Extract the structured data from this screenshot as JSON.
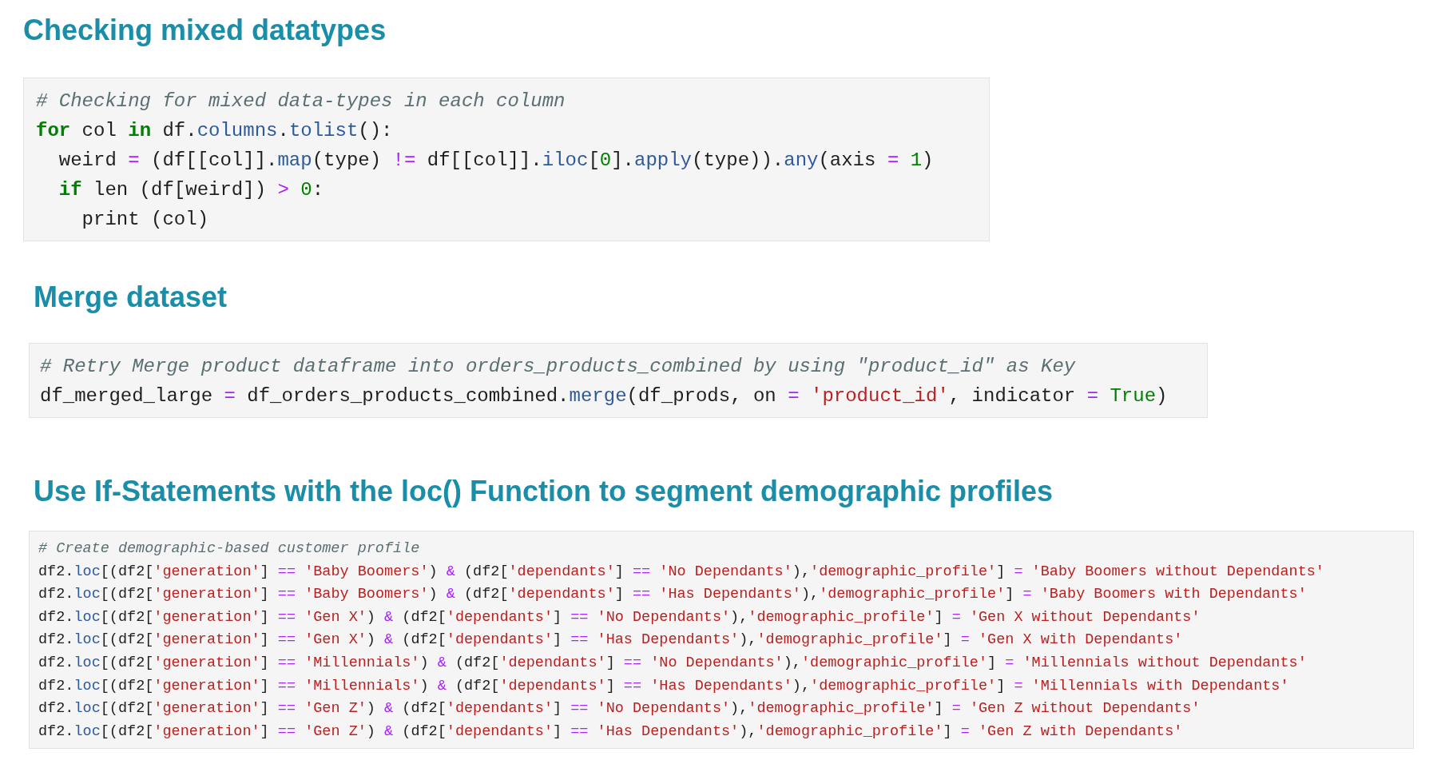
{
  "sections": [
    {
      "heading": "Checking mixed datatypes",
      "code_lines": [
        [
          {
            "kind": "comment",
            "text": "# Checking for mixed data-types in each column"
          }
        ],
        [
          {
            "kind": "keyword",
            "text": "for"
          },
          {
            "kind": "plain",
            "text": " col "
          },
          {
            "kind": "keyword",
            "text": "in"
          },
          {
            "kind": "plain",
            "text": " df."
          },
          {
            "kind": "attribute",
            "text": "columns"
          },
          {
            "kind": "plain",
            "text": "."
          },
          {
            "kind": "attribute",
            "text": "tolist"
          },
          {
            "kind": "plain",
            "text": "():"
          }
        ],
        [
          {
            "kind": "plain",
            "text": "  weird "
          },
          {
            "kind": "operator",
            "text": "= "
          },
          {
            "kind": "plain",
            "text": "(df[[col]]."
          },
          {
            "kind": "attribute",
            "text": "map"
          },
          {
            "kind": "plain",
            "text": "(type) "
          },
          {
            "kind": "operator",
            "text": "!= "
          },
          {
            "kind": "plain",
            "text": "df[[col]]."
          },
          {
            "kind": "attribute",
            "text": "iloc"
          },
          {
            "kind": "plain",
            "text": "["
          },
          {
            "kind": "number",
            "text": "0"
          },
          {
            "kind": "plain",
            "text": "]."
          },
          {
            "kind": "attribute",
            "text": "apply"
          },
          {
            "kind": "plain",
            "text": "(type))."
          },
          {
            "kind": "attribute",
            "text": "any"
          },
          {
            "kind": "plain",
            "text": "(axis "
          },
          {
            "kind": "operator",
            "text": "= "
          },
          {
            "kind": "number",
            "text": "1"
          },
          {
            "kind": "plain",
            "text": ")"
          }
        ],
        [
          {
            "kind": "keyword",
            "text": "  if"
          },
          {
            "kind": "plain",
            "text": " len (df[weird]) "
          },
          {
            "kind": "operator",
            "text": "> "
          },
          {
            "kind": "number",
            "text": "0"
          },
          {
            "kind": "plain",
            "text": ":"
          }
        ],
        [
          {
            "kind": "plain",
            "text": "    print (col)"
          }
        ]
      ]
    },
    {
      "heading": "Merge dataset",
      "code_lines": [
        [
          {
            "kind": "comment",
            "text": "# Retry Merge product dataframe into orders_products_combined by using \"product_id\" as Key"
          }
        ],
        [
          {
            "kind": "plain",
            "text": "df_merged_large "
          },
          {
            "kind": "operator",
            "text": "= "
          },
          {
            "kind": "plain",
            "text": "df_orders_products_combined."
          },
          {
            "kind": "attribute",
            "text": "merge"
          },
          {
            "kind": "plain",
            "text": "(df_prods, on "
          },
          {
            "kind": "operator",
            "text": "= "
          },
          {
            "kind": "string",
            "text": "'product_id'"
          },
          {
            "kind": "plain",
            "text": ", indicator "
          },
          {
            "kind": "operator",
            "text": "= "
          },
          {
            "kind": "constant",
            "text": "True"
          },
          {
            "kind": "plain",
            "text": ")"
          }
        ]
      ]
    },
    {
      "heading": "Use If-Statements with the loc() Function to segment demographic profiles",
      "code_lines": [
        [
          {
            "kind": "comment",
            "text": "# Create demographic-based customer profile"
          }
        ],
        [
          {
            "kind": "plain",
            "text": "df2."
          },
          {
            "kind": "attribute",
            "text": "loc"
          },
          {
            "kind": "plain",
            "text": "[(df2["
          },
          {
            "kind": "string",
            "text": "'generation'"
          },
          {
            "kind": "plain",
            "text": "] "
          },
          {
            "kind": "operator",
            "text": "== "
          },
          {
            "kind": "string",
            "text": "'Baby Boomers'"
          },
          {
            "kind": "plain",
            "text": ") "
          },
          {
            "kind": "operator",
            "text": "&"
          },
          {
            "kind": "plain",
            "text": " (df2["
          },
          {
            "kind": "string",
            "text": "'dependants'"
          },
          {
            "kind": "plain",
            "text": "] "
          },
          {
            "kind": "operator",
            "text": "== "
          },
          {
            "kind": "string",
            "text": "'No Dependants'"
          },
          {
            "kind": "plain",
            "text": "),"
          },
          {
            "kind": "string",
            "text": "'demographic_profile'"
          },
          {
            "kind": "plain",
            "text": "] "
          },
          {
            "kind": "operator",
            "text": "= "
          },
          {
            "kind": "string",
            "text": "'Baby Boomers without Dependants'"
          }
        ],
        [
          {
            "kind": "plain",
            "text": "df2."
          },
          {
            "kind": "attribute",
            "text": "loc"
          },
          {
            "kind": "plain",
            "text": "[(df2["
          },
          {
            "kind": "string",
            "text": "'generation'"
          },
          {
            "kind": "plain",
            "text": "] "
          },
          {
            "kind": "operator",
            "text": "== "
          },
          {
            "kind": "string",
            "text": "'Baby Boomers'"
          },
          {
            "kind": "plain",
            "text": ") "
          },
          {
            "kind": "operator",
            "text": "&"
          },
          {
            "kind": "plain",
            "text": " (df2["
          },
          {
            "kind": "string",
            "text": "'dependants'"
          },
          {
            "kind": "plain",
            "text": "] "
          },
          {
            "kind": "operator",
            "text": "== "
          },
          {
            "kind": "string",
            "text": "'Has Dependants'"
          },
          {
            "kind": "plain",
            "text": "),"
          },
          {
            "kind": "string",
            "text": "'demographic_profile'"
          },
          {
            "kind": "plain",
            "text": "] "
          },
          {
            "kind": "operator",
            "text": "= "
          },
          {
            "kind": "string",
            "text": "'Baby Boomers with Dependants'"
          }
        ],
        [
          {
            "kind": "plain",
            "text": "df2."
          },
          {
            "kind": "attribute",
            "text": "loc"
          },
          {
            "kind": "plain",
            "text": "[(df2["
          },
          {
            "kind": "string",
            "text": "'generation'"
          },
          {
            "kind": "plain",
            "text": "] "
          },
          {
            "kind": "operator",
            "text": "== "
          },
          {
            "kind": "string",
            "text": "'Gen X'"
          },
          {
            "kind": "plain",
            "text": ") "
          },
          {
            "kind": "operator",
            "text": "&"
          },
          {
            "kind": "plain",
            "text": " (df2["
          },
          {
            "kind": "string",
            "text": "'dependants'"
          },
          {
            "kind": "plain",
            "text": "] "
          },
          {
            "kind": "operator",
            "text": "== "
          },
          {
            "kind": "string",
            "text": "'No Dependants'"
          },
          {
            "kind": "plain",
            "text": "),"
          },
          {
            "kind": "string",
            "text": "'demographic_profile'"
          },
          {
            "kind": "plain",
            "text": "] "
          },
          {
            "kind": "operator",
            "text": "= "
          },
          {
            "kind": "string",
            "text": "'Gen X without Dependants'"
          }
        ],
        [
          {
            "kind": "plain",
            "text": "df2."
          },
          {
            "kind": "attribute",
            "text": "loc"
          },
          {
            "kind": "plain",
            "text": "[(df2["
          },
          {
            "kind": "string",
            "text": "'generation'"
          },
          {
            "kind": "plain",
            "text": "] "
          },
          {
            "kind": "operator",
            "text": "== "
          },
          {
            "kind": "string",
            "text": "'Gen X'"
          },
          {
            "kind": "plain",
            "text": ") "
          },
          {
            "kind": "operator",
            "text": "&"
          },
          {
            "kind": "plain",
            "text": " (df2["
          },
          {
            "kind": "string",
            "text": "'dependants'"
          },
          {
            "kind": "plain",
            "text": "] "
          },
          {
            "kind": "operator",
            "text": "== "
          },
          {
            "kind": "string",
            "text": "'Has Dependants'"
          },
          {
            "kind": "plain",
            "text": "),"
          },
          {
            "kind": "string",
            "text": "'demographic_profile'"
          },
          {
            "kind": "plain",
            "text": "] "
          },
          {
            "kind": "operator",
            "text": "= "
          },
          {
            "kind": "string",
            "text": "'Gen X with Dependants'"
          }
        ],
        [
          {
            "kind": "plain",
            "text": "df2."
          },
          {
            "kind": "attribute",
            "text": "loc"
          },
          {
            "kind": "plain",
            "text": "[(df2["
          },
          {
            "kind": "string",
            "text": "'generation'"
          },
          {
            "kind": "plain",
            "text": "] "
          },
          {
            "kind": "operator",
            "text": "== "
          },
          {
            "kind": "string",
            "text": "'Millennials'"
          },
          {
            "kind": "plain",
            "text": ") "
          },
          {
            "kind": "operator",
            "text": "&"
          },
          {
            "kind": "plain",
            "text": " (df2["
          },
          {
            "kind": "string",
            "text": "'dependants'"
          },
          {
            "kind": "plain",
            "text": "] "
          },
          {
            "kind": "operator",
            "text": "== "
          },
          {
            "kind": "string",
            "text": "'No Dependants'"
          },
          {
            "kind": "plain",
            "text": "),"
          },
          {
            "kind": "string",
            "text": "'demographic_profile'"
          },
          {
            "kind": "plain",
            "text": "] "
          },
          {
            "kind": "operator",
            "text": "= "
          },
          {
            "kind": "string",
            "text": "'Millennials without Dependants'"
          }
        ],
        [
          {
            "kind": "plain",
            "text": "df2."
          },
          {
            "kind": "attribute",
            "text": "loc"
          },
          {
            "kind": "plain",
            "text": "[(df2["
          },
          {
            "kind": "string",
            "text": "'generation'"
          },
          {
            "kind": "plain",
            "text": "] "
          },
          {
            "kind": "operator",
            "text": "== "
          },
          {
            "kind": "string",
            "text": "'Millennials'"
          },
          {
            "kind": "plain",
            "text": ") "
          },
          {
            "kind": "operator",
            "text": "&"
          },
          {
            "kind": "plain",
            "text": " (df2["
          },
          {
            "kind": "string",
            "text": "'dependants'"
          },
          {
            "kind": "plain",
            "text": "] "
          },
          {
            "kind": "operator",
            "text": "== "
          },
          {
            "kind": "string",
            "text": "'Has Dependants'"
          },
          {
            "kind": "plain",
            "text": "),"
          },
          {
            "kind": "string",
            "text": "'demographic_profile'"
          },
          {
            "kind": "plain",
            "text": "] "
          },
          {
            "kind": "operator",
            "text": "= "
          },
          {
            "kind": "string",
            "text": "'Millennials with Dependants'"
          }
        ],
        [
          {
            "kind": "plain",
            "text": "df2."
          },
          {
            "kind": "attribute",
            "text": "loc"
          },
          {
            "kind": "plain",
            "text": "[(df2["
          },
          {
            "kind": "string",
            "text": "'generation'"
          },
          {
            "kind": "plain",
            "text": "] "
          },
          {
            "kind": "operator",
            "text": "== "
          },
          {
            "kind": "string",
            "text": "'Gen Z'"
          },
          {
            "kind": "plain",
            "text": ") "
          },
          {
            "kind": "operator",
            "text": "&"
          },
          {
            "kind": "plain",
            "text": " (df2["
          },
          {
            "kind": "string",
            "text": "'dependants'"
          },
          {
            "kind": "plain",
            "text": "] "
          },
          {
            "kind": "operator",
            "text": "== "
          },
          {
            "kind": "string",
            "text": "'No Dependants'"
          },
          {
            "kind": "plain",
            "text": "),"
          },
          {
            "kind": "string",
            "text": "'demographic_profile'"
          },
          {
            "kind": "plain",
            "text": "] "
          },
          {
            "kind": "operator",
            "text": "= "
          },
          {
            "kind": "string",
            "text": "'Gen Z without Dependants'"
          }
        ],
        [
          {
            "kind": "plain",
            "text": "df2."
          },
          {
            "kind": "attribute",
            "text": "loc"
          },
          {
            "kind": "plain",
            "text": "[(df2["
          },
          {
            "kind": "string",
            "text": "'generation'"
          },
          {
            "kind": "plain",
            "text": "] "
          },
          {
            "kind": "operator",
            "text": "== "
          },
          {
            "kind": "string",
            "text": "'Gen Z'"
          },
          {
            "kind": "plain",
            "text": ") "
          },
          {
            "kind": "operator",
            "text": "&"
          },
          {
            "kind": "plain",
            "text": " (df2["
          },
          {
            "kind": "string",
            "text": "'dependants'"
          },
          {
            "kind": "plain",
            "text": "] "
          },
          {
            "kind": "operator",
            "text": "== "
          },
          {
            "kind": "string",
            "text": "'Has Dependants'"
          },
          {
            "kind": "plain",
            "text": "),"
          },
          {
            "kind": "string",
            "text": "'demographic_profile'"
          },
          {
            "kind": "plain",
            "text": "] "
          },
          {
            "kind": "operator",
            "text": "= "
          },
          {
            "kind": "string",
            "text": "'Gen Z with Dependants'"
          }
        ]
      ]
    }
  ]
}
